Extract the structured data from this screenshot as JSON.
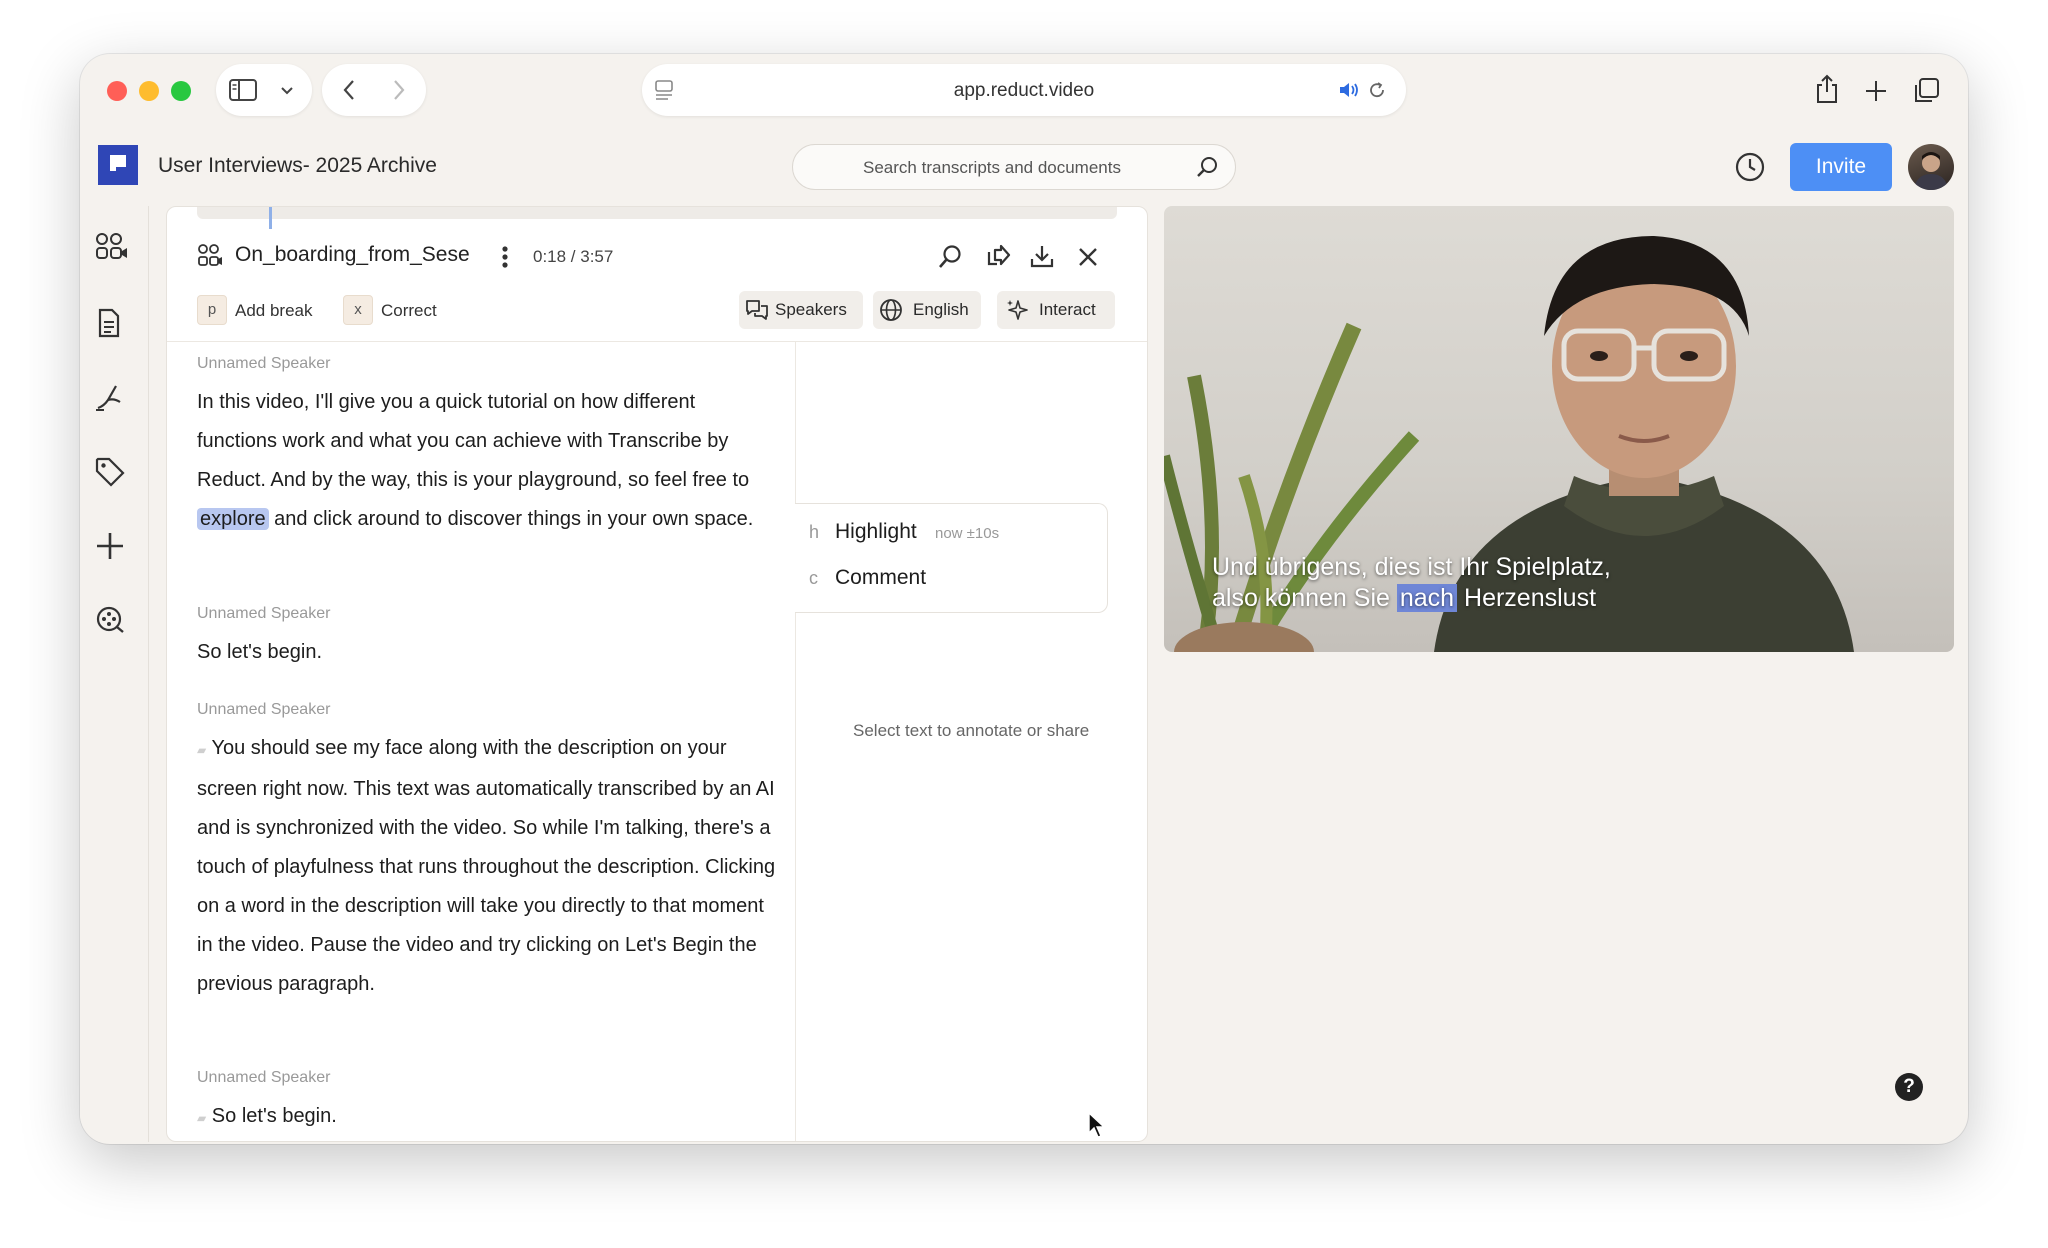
{
  "browser": {
    "url": "app.reduct.video"
  },
  "header": {
    "app_title": "User Interviews- 2025 Archive",
    "search_placeholder": "Search transcripts and documents",
    "invite_label": "Invite"
  },
  "document": {
    "title": "On_boarding_from_Sese",
    "time": "0:18 / 3:57",
    "toolbar": {
      "add_break_key": "p",
      "add_break_label": "Add break",
      "correct_key": "x",
      "correct_label": "Correct",
      "speakers_label": "Speakers",
      "language_label": "English",
      "interact_label": "Interact"
    }
  },
  "transcript": [
    {
      "speaker": "Unnamed Speaker",
      "text_before": "In this video, I'll give you a quick tutorial on how different functions work and what you can achieve with Transcribe by Reduct. And by the way, this is your playground, so feel free to ",
      "highlight": "explore",
      "text_after": " and click around to discover things in your own space."
    },
    {
      "speaker": "Unnamed Speaker",
      "text": "So let's begin."
    },
    {
      "speaker": "Unnamed Speaker",
      "text": "You should see my face along with the description on your screen right now. This text was automatically transcribed by an AI and is synchronized with the video. So while I'm talking, there's a touch of playfulness that runs throughout the description. Clicking on a word in the description will take you directly to that moment in the video. Pause the video and try clicking on Let's Begin the previous paragraph."
    },
    {
      "speaker": "Unnamed Speaker",
      "text": "So let's begin."
    }
  ],
  "annotation": {
    "highlight_key": "h",
    "highlight_label": "Highlight",
    "highlight_sub": "now ±10s",
    "comment_key": "c",
    "comment_label": "Comment",
    "hint": "Select text to annotate or share"
  },
  "video": {
    "caption_line1": "Und übrigens, dies ist Ihr Spielplatz,",
    "caption_line2_before": "also können Sie ",
    "caption_line2_highlight": "nach",
    "caption_line2_after": " Herzenslust"
  },
  "help": {
    "label": "?"
  },
  "colors": {
    "accent": "#4d8ff5",
    "brand": "#2f46b6",
    "highlight": "#b8c7f0"
  }
}
